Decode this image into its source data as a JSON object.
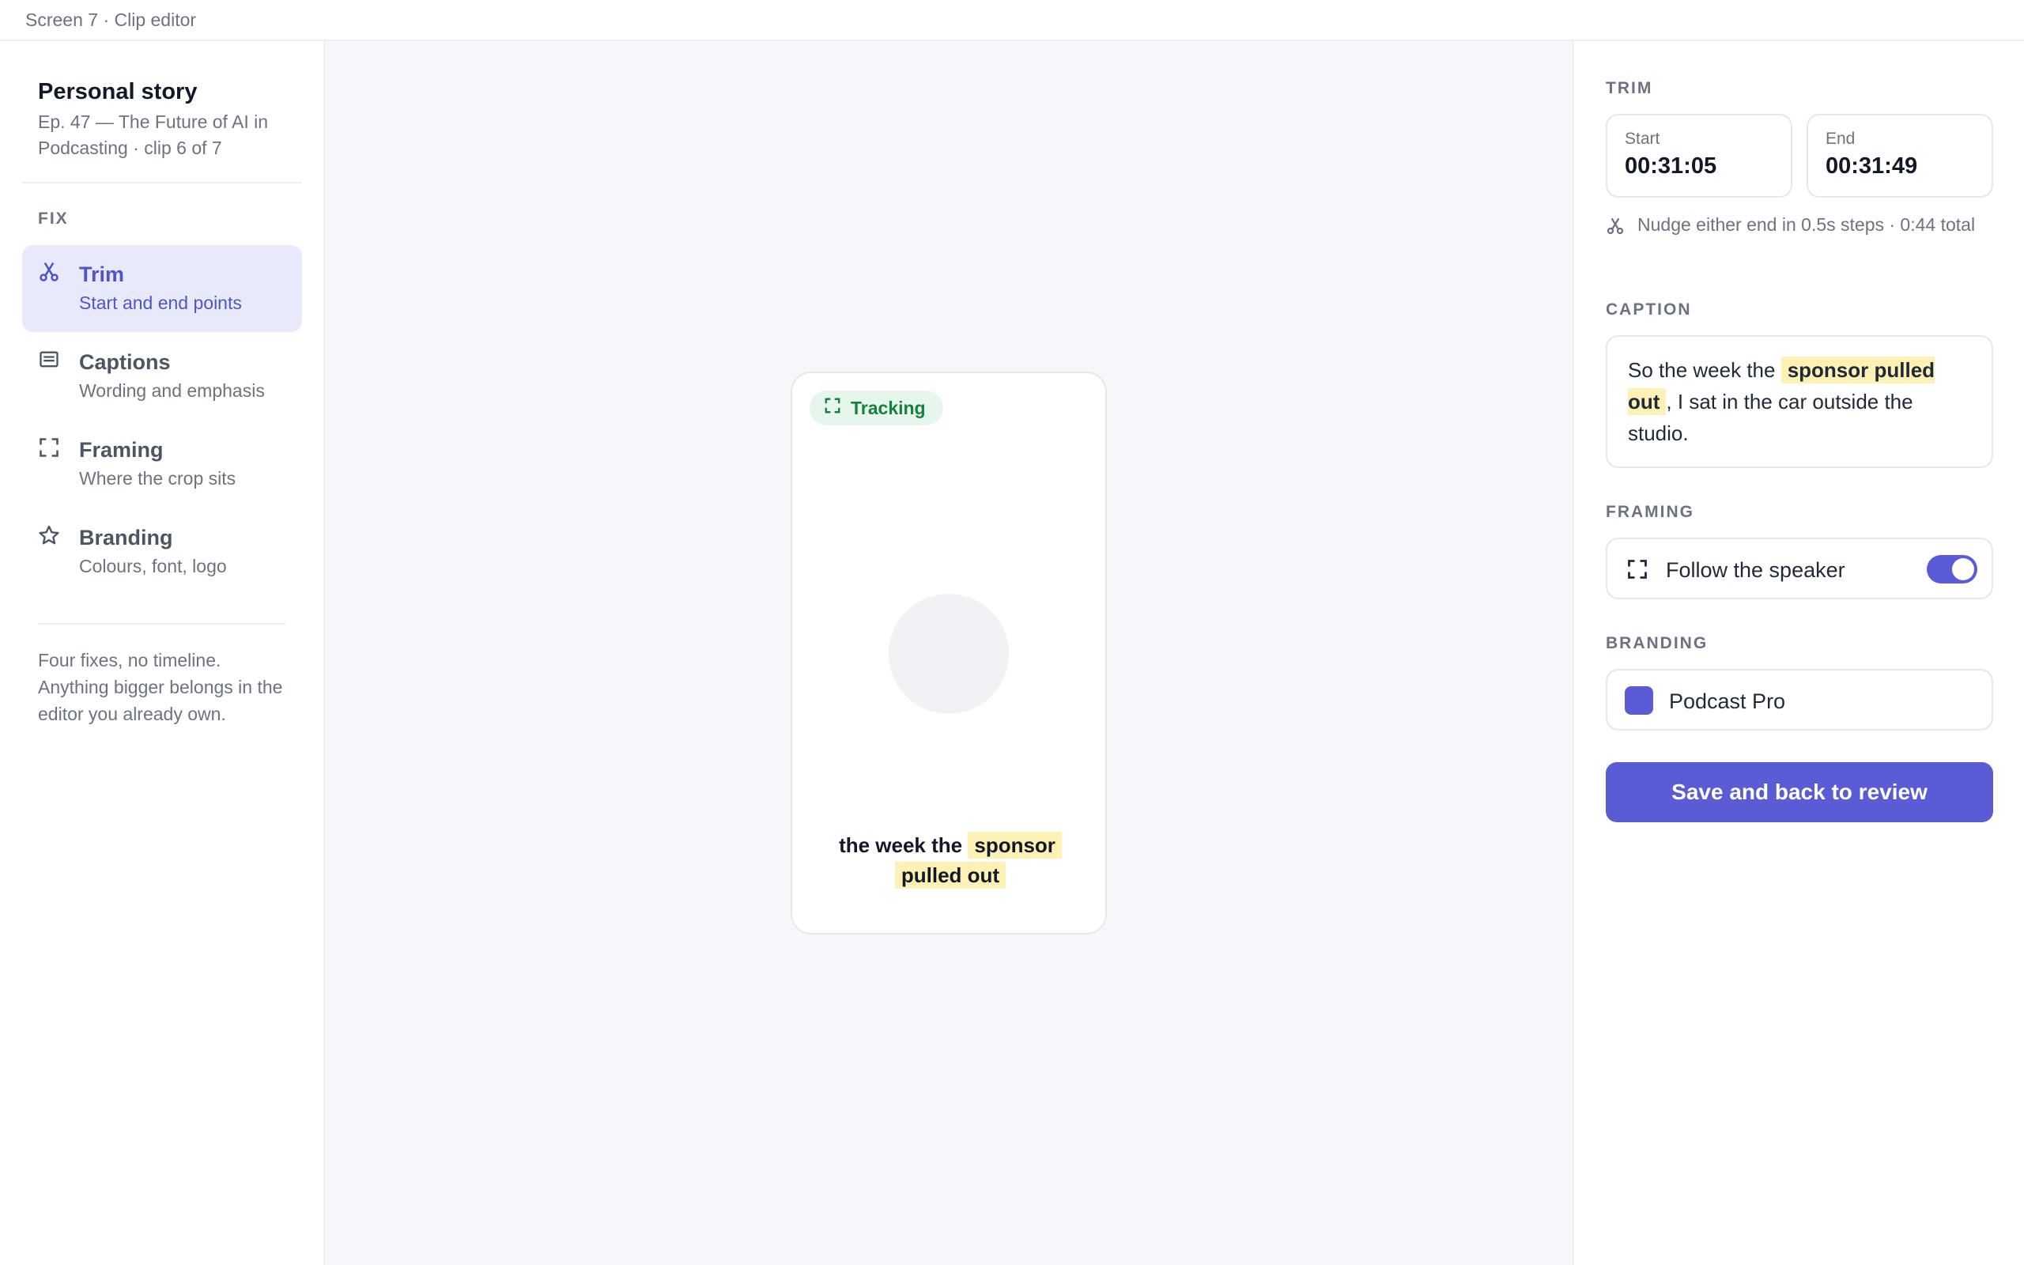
{
  "topbar": {
    "title": "Screen 7 · Clip editor"
  },
  "project": {
    "title": "Personal story",
    "subtitle": "Ep. 47 — The Future of AI in Podcasting · clip 6 of 7"
  },
  "sidebar": {
    "section_label": "FIX",
    "items": [
      {
        "label": "Trim",
        "desc": "Start and end points",
        "icon": "scissors-icon",
        "active": true
      },
      {
        "label": "Captions",
        "desc": "Wording and emphasis",
        "icon": "captions-icon",
        "active": false
      },
      {
        "label": "Framing",
        "desc": "Where the crop sits",
        "icon": "frame-icon",
        "active": false
      },
      {
        "label": "Branding",
        "desc": "Colours, font, logo",
        "icon": "star-icon",
        "active": false
      }
    ],
    "note": "Four fixes, no timeline. Anything bigger belongs in the editor you already own."
  },
  "preview": {
    "tracking_label": "Tracking",
    "caption_plain": "the week the",
    "caption_highlight_1": "sponsor",
    "caption_highlight_2": "pulled out"
  },
  "panel": {
    "trim": {
      "label": "TRIM",
      "start_label": "Start",
      "start_value": "00:31:05",
      "end_label": "End",
      "end_value": "00:31:49",
      "hint": "Nudge either end in 0.5s steps · 0:44 total"
    },
    "caption": {
      "label": "CAPTION",
      "before": "So the week the",
      "highlight": "sponsor pulled out",
      "after": ", I sat in the car outside the studio."
    },
    "framing": {
      "label": "FRAMING",
      "option": "Follow the speaker",
      "enabled": true
    },
    "branding": {
      "label": "BRANDING",
      "preset": "Podcast Pro",
      "swatch_color": "#5b5bd6"
    },
    "save_label": "Save and back to review"
  },
  "colors": {
    "accent": "#5b5bd6",
    "active_bg": "#e8eafb",
    "highlight": "#fdf1b6",
    "tracking_green": "#16803c"
  }
}
